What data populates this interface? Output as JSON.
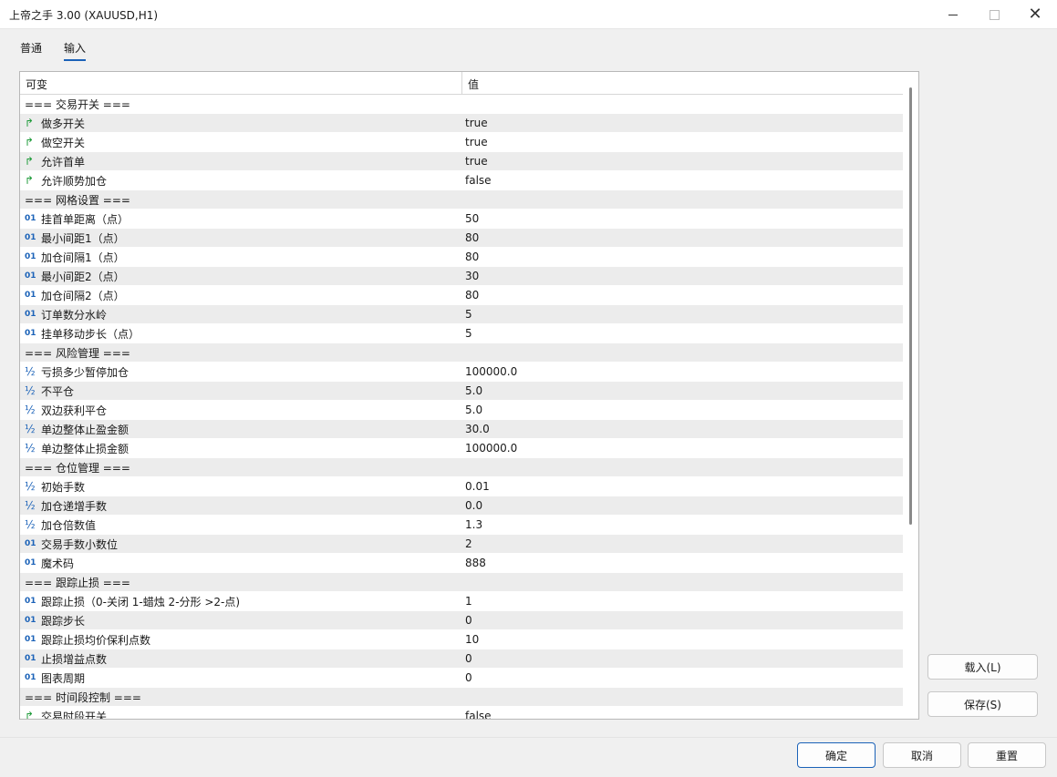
{
  "window": {
    "title": "上帝之手 3.00 (XAUUSD,H1)",
    "close_glyph": "✕"
  },
  "tabs": [
    {
      "label": "普通",
      "active": false
    },
    {
      "label": "输入",
      "active": true
    }
  ],
  "grid": {
    "columns": [
      "可变",
      "值"
    ],
    "rows": [
      {
        "type": "section",
        "name": "=== 交易开关 ===",
        "value": ""
      },
      {
        "type": "bool",
        "name": "做多开关",
        "value": "true"
      },
      {
        "type": "bool",
        "name": "做空开关",
        "value": "true"
      },
      {
        "type": "bool",
        "name": "允许首单",
        "value": "true"
      },
      {
        "type": "bool",
        "name": "允许顺势加仓",
        "value": "false"
      },
      {
        "type": "section",
        "name": "=== 网格设置 ===",
        "value": ""
      },
      {
        "type": "int",
        "name": "挂首单距离（点）",
        "value": "50"
      },
      {
        "type": "int",
        "name": "最小间距1（点）",
        "value": "80"
      },
      {
        "type": "int",
        "name": "加仓间隔1（点）",
        "value": "80"
      },
      {
        "type": "int",
        "name": "最小间距2（点）",
        "value": "30"
      },
      {
        "type": "int",
        "name": "加仓间隔2（点）",
        "value": "80"
      },
      {
        "type": "int",
        "name": "订单数分水岭",
        "value": "5"
      },
      {
        "type": "int",
        "name": "挂单移动步长（点）",
        "value": "5"
      },
      {
        "type": "section",
        "name": "=== 风险管理 ===",
        "value": ""
      },
      {
        "type": "double",
        "name": "亏损多少暂停加仓",
        "value": "100000.0"
      },
      {
        "type": "double",
        "name": "不平仓",
        "value": "5.0"
      },
      {
        "type": "double",
        "name": "双边获利平仓",
        "value": "5.0"
      },
      {
        "type": "double",
        "name": "单边整体止盈金额",
        "value": "30.0"
      },
      {
        "type": "double",
        "name": "单边整体止损金额",
        "value": "100000.0"
      },
      {
        "type": "section",
        "name": "=== 仓位管理 ===",
        "value": ""
      },
      {
        "type": "double",
        "name": "初始手数",
        "value": "0.01"
      },
      {
        "type": "double",
        "name": "加仓递增手数",
        "value": "0.0"
      },
      {
        "type": "double",
        "name": "加仓倍数值",
        "value": "1.3"
      },
      {
        "type": "int",
        "name": "交易手数小数位",
        "value": "2"
      },
      {
        "type": "int",
        "name": "魔术码",
        "value": "888"
      },
      {
        "type": "section",
        "name": "=== 跟踪止损 ===",
        "value": ""
      },
      {
        "type": "int",
        "name": "跟踪止损（0-关闭 1-蜡烛 2-分形 >2-点)",
        "value": "1"
      },
      {
        "type": "int",
        "name": "跟踪步长",
        "value": "0"
      },
      {
        "type": "int",
        "name": "跟踪止损均价保利点数",
        "value": "10"
      },
      {
        "type": "int",
        "name": "止损增益点数",
        "value": "0"
      },
      {
        "type": "int",
        "name": "图表周期",
        "value": "0"
      },
      {
        "type": "section",
        "name": "=== 时间段控制 ===",
        "value": ""
      },
      {
        "type": "bool",
        "name": "交易时段开关",
        "value": "false"
      }
    ]
  },
  "icons": {
    "bool": "↱",
    "int": "01",
    "double": "½"
  },
  "buttons": {
    "load": "载入(L)",
    "save": "保存(S)",
    "ok": "确定",
    "cancel": "取消",
    "reset": "重置"
  }
}
